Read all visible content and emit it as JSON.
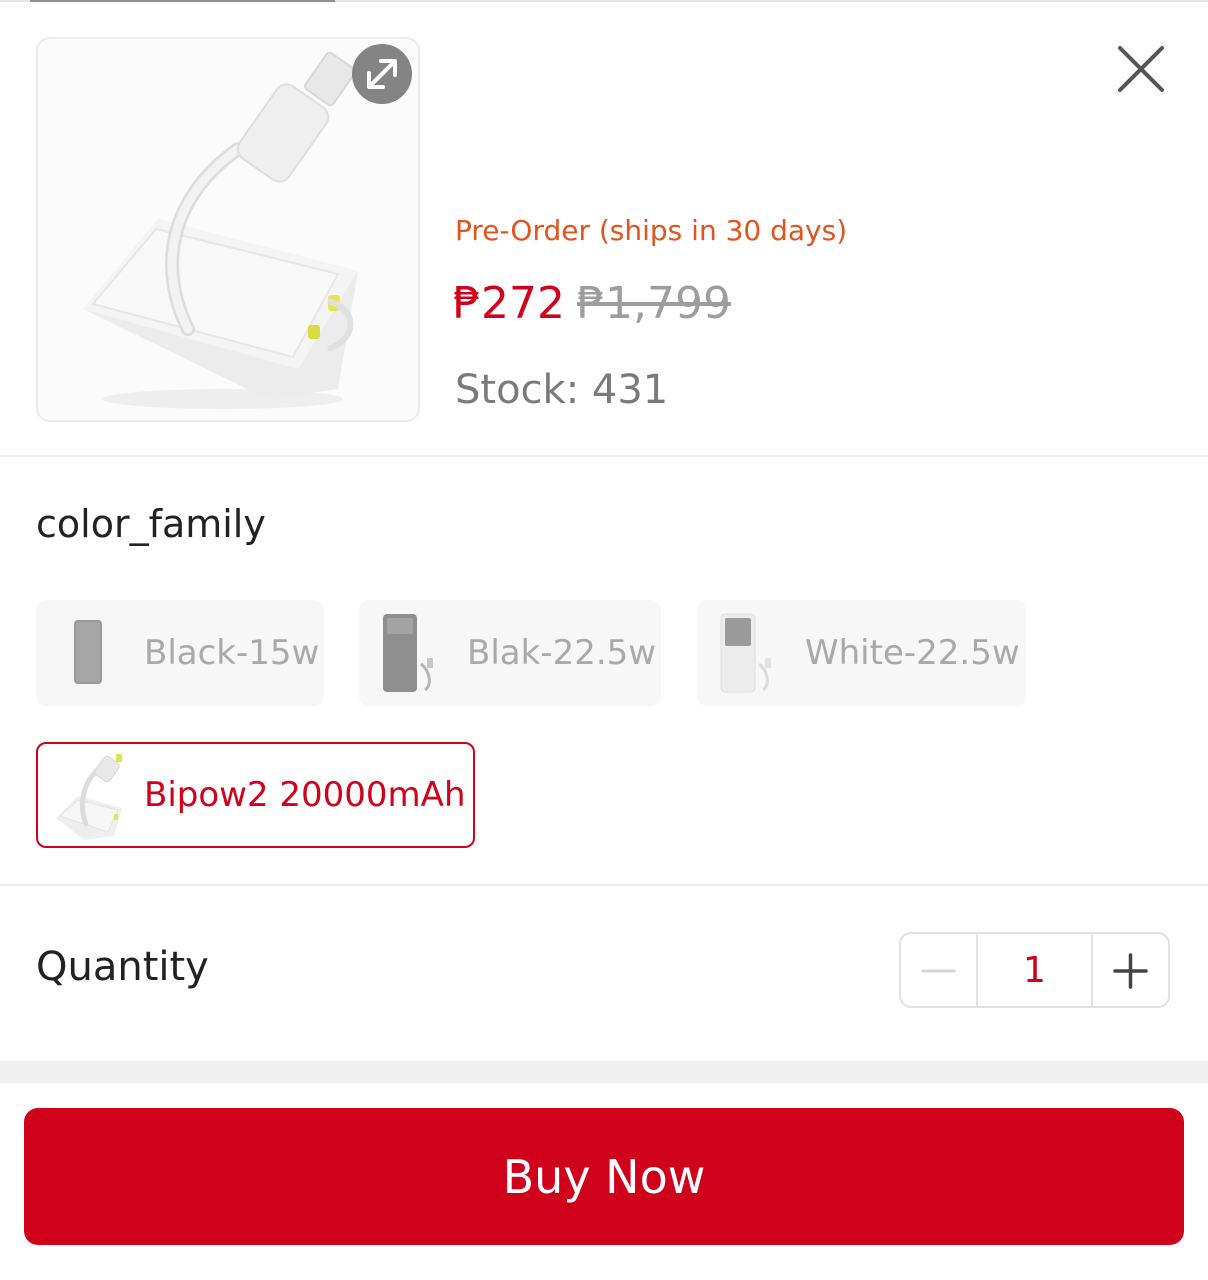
{
  "product": {
    "preorder_text": "Pre-Order (ships in 30 days)",
    "price_current": "₱272",
    "price_original": "₱1,799",
    "stock_text": "Stock: 431"
  },
  "icons": {
    "expand": "expand-arrows-icon",
    "close": "close-x-icon",
    "minus": "minus-icon",
    "plus": "plus-icon"
  },
  "variants": {
    "title": "color_family",
    "options": [
      {
        "label": "Black-15w",
        "state": "disabled"
      },
      {
        "label": "Blak-22.5w",
        "state": "disabled"
      },
      {
        "label": "White-22.5w",
        "state": "disabled"
      },
      {
        "label": "Bipow2 20000mAh",
        "state": "selected"
      }
    ]
  },
  "quantity": {
    "label": "Quantity",
    "value": "1"
  },
  "footer": {
    "buy_now_label": "Buy Now"
  },
  "colors": {
    "accent": "#d0011b",
    "preorder": "#e2541b",
    "muted_text": "#a9a9a9"
  }
}
